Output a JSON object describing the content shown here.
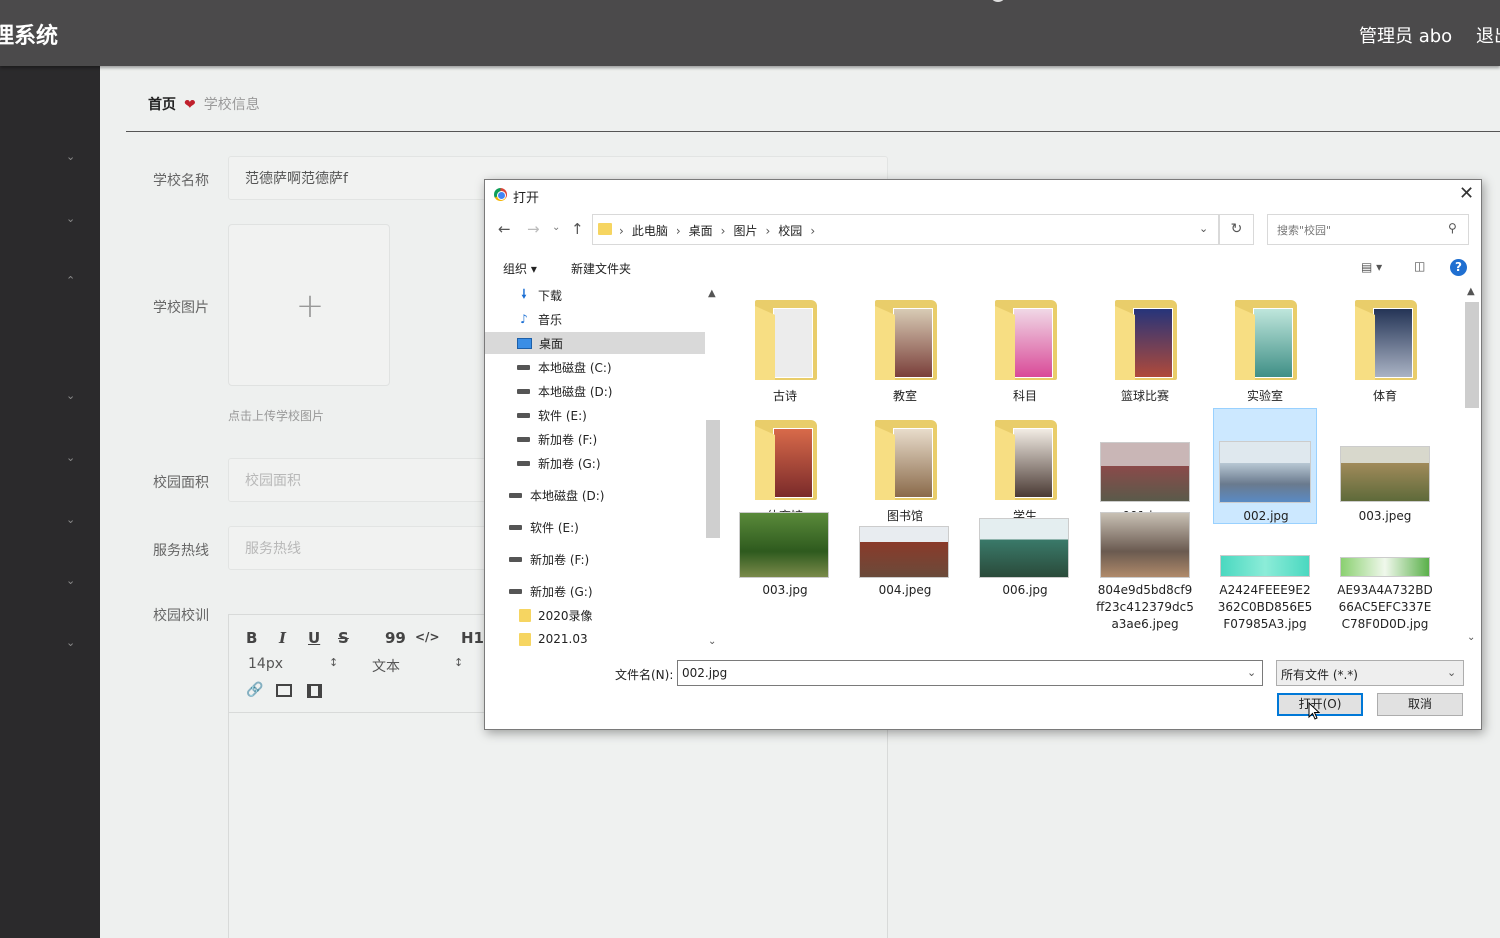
{
  "header": {
    "title": "理系统",
    "user": "管理员 abo",
    "logout": "退出"
  },
  "sidebar": {
    "items": [
      {
        "icon": "chevron-down-icon"
      },
      {
        "icon": "chevron-down-icon"
      },
      {
        "icon": "chevron-up-icon"
      },
      {
        "icon": "chevron-down-icon"
      },
      {
        "icon": "chevron-down-icon"
      },
      {
        "icon": "chevron-down-icon"
      },
      {
        "icon": "chevron-down-icon"
      },
      {
        "icon": "chevron-down-icon"
      }
    ]
  },
  "breadcrumb": {
    "home": "首页",
    "current": "学校信息"
  },
  "form": {
    "name_label": "学校名称",
    "name_value": "范德萨啊范德萨f",
    "image_label": "学校图片",
    "upload_hint": "点击上传学校图片",
    "area_label": "校园面积",
    "area_placeholder": "校园面积",
    "hotline_label": "服务热线",
    "hotline_placeholder": "服务热线",
    "motto_label": "校园校训"
  },
  "editor": {
    "font_size": "14px",
    "format": "文本",
    "buttons": [
      "B",
      "I",
      "U",
      "S",
      "99",
      "</>",
      "H1"
    ]
  },
  "dialog": {
    "title": "打开",
    "path": [
      "此电脑",
      "桌面",
      "图片",
      "校园"
    ],
    "search_placeholder": "搜索\"校园\"",
    "organize": "组织 ▾",
    "new_folder": "新建文件夹",
    "tree": [
      {
        "label": "下载",
        "icon": "download-icon"
      },
      {
        "label": "音乐",
        "icon": "music-icon"
      },
      {
        "label": "桌面",
        "icon": "desktop-icon",
        "selected": true
      },
      {
        "label": "本地磁盘 (C:)",
        "icon": "drive-icon"
      },
      {
        "label": "本地磁盘 (D:)",
        "icon": "drive-icon"
      },
      {
        "label": "软件 (E:)",
        "icon": "drive-icon"
      },
      {
        "label": "新加卷 (F:)",
        "icon": "drive-icon"
      },
      {
        "label": "新加卷 (G:)",
        "icon": "drive-icon"
      },
      {
        "label": "本地磁盘 (D:)",
        "icon": "drive-icon"
      },
      {
        "label": "软件 (E:)",
        "icon": "drive-icon"
      },
      {
        "label": "新加卷 (F:)",
        "icon": "drive-icon"
      },
      {
        "label": "新加卷 (G:)",
        "icon": "drive-icon"
      },
      {
        "label": "2020录像",
        "icon": "folder-icon"
      },
      {
        "label": "2021.03",
        "icon": "folder-icon"
      }
    ],
    "files": [
      {
        "name": "古诗",
        "kind": "folder",
        "color": "#e8e8e8"
      },
      {
        "name": "教室",
        "kind": "folder",
        "color": "#c9b8a0"
      },
      {
        "name": "科目",
        "kind": "folder",
        "color": "#e6a2c8"
      },
      {
        "name": "篮球比赛",
        "kind": "folder",
        "color": "#3a4c8c"
      },
      {
        "name": "实验室",
        "kind": "folder",
        "color": "#6dbfb0"
      },
      {
        "name": "体育",
        "kind": "folder",
        "color": "#3b4a66"
      },
      {
        "name": "体育馆",
        "kind": "folder",
        "color": "#b5483a"
      },
      {
        "name": "图书馆",
        "kind": "folder",
        "color": "#b59a7a"
      },
      {
        "name": "学生",
        "kind": "folder",
        "color": "#d9c9b8"
      },
      {
        "name": "001.jpg",
        "kind": "image",
        "color": "#6b6070"
      },
      {
        "name": "002.jpg",
        "kind": "image",
        "color": "#8aa4b8",
        "selected": true
      },
      {
        "name": "003.jpeg",
        "kind": "image",
        "color": "#8a7a5c"
      },
      {
        "name": "003.jpg",
        "kind": "image",
        "color": "#3f6b2c"
      },
      {
        "name": "004.jpeg",
        "kind": "image",
        "color": "#7a4a3a"
      },
      {
        "name": "006.jpg",
        "kind": "image",
        "color": "#4e8a78"
      },
      {
        "name": "804e9d5bd8cf9ff23c412379dc5a3ae6.jpeg",
        "kind": "image",
        "color": "#9a8070"
      },
      {
        "name": "A2424FEEE9E2362C0BD856E5F07985A3.jpg",
        "kind": "image",
        "color": "#5fd6c0"
      },
      {
        "name": "AE93A4A732BD66AC5EFC337EC78F0D0D.jpg",
        "kind": "image",
        "color": "#6bc06a"
      }
    ],
    "filename_label": "文件名(N):",
    "filename_value": "002.jpg",
    "filetype": "所有文件 (*.*)",
    "open_btn": "打开(O)",
    "cancel_btn": "取消"
  },
  "colors": {
    "topbar": "#4b4a4b",
    "sidebar": "#2b2a2c",
    "heart": "#c0202c",
    "selection": "#cce8ff",
    "primary_border": "#0078d7"
  }
}
